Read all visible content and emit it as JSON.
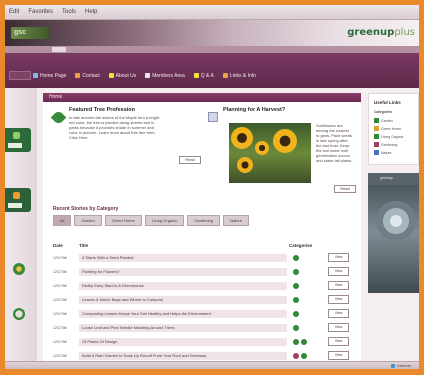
{
  "os_menu": [
    "Edit",
    "Favorites",
    "Tools",
    "Help"
  ],
  "site": {
    "logo_text": "gsc",
    "brand_main": "greenup",
    "brand_suffix": "plus"
  },
  "nav": {
    "first": "",
    "items": [
      {
        "label": "Home Page",
        "color": "#7fc0e8"
      },
      {
        "label": "Contact",
        "color": "#f0a040"
      },
      {
        "label": "About Us",
        "color": "#f0e040"
      },
      {
        "label": "Members Area",
        "color": "#e8e8e8"
      },
      {
        "label": "Q & A",
        "color": "#f0e040"
      },
      {
        "label": "Links & Info",
        "color": "#f0a040"
      }
    ]
  },
  "main": {
    "header": "Home",
    "feature_left": {
      "title": "Featured Tree Profession",
      "lines": [
        "In late autumn the leaves of the Maple turn a bright",
        "red color, the tree is planted along streets and in",
        "parks because it provides shade in summer and",
        "color in autumn. Learn more about this tree here.",
        "Click Here"
      ],
      "button": "Read"
    },
    "feature_right": {
      "title": "Planning for A Harvest?",
      "lines": [
        "Sunflowers are",
        "among the easiest",
        "to grow. Plant seeds",
        "in late spring after",
        "the last frost. Keep",
        "the soil moist until",
        "germination occurs",
        "and stake tall plants."
      ],
      "button": "Read"
    },
    "categories_title": "Recent Stories by Category",
    "tabs": [
      "All",
      "Garden",
      "Green Home",
      "Living Organic",
      "Gardening",
      "Nature"
    ],
    "table_headers": {
      "date": "Date",
      "title": "Title",
      "categories": "Categories"
    },
    "rows": [
      {
        "date": "12/17/06",
        "title": "It Starts With a Seed Planted",
        "cats": [
          "#2f8a35"
        ],
        "btn": "View"
      },
      {
        "date": "12/17/06",
        "title": "Planting for Flowers?",
        "cats": [
          "#2f8a35"
        ],
        "btn": "View"
      },
      {
        "date": "12/17/06",
        "title": "Really Early Start to A Greenhouse",
        "cats": [
          "#2f8a35"
        ],
        "btn": "View"
      },
      {
        "date": "12/17/06",
        "title": "Leaves & Mulch Bags and Where to Compost",
        "cats": [
          "#2f8a35"
        ],
        "btn": "View"
      },
      {
        "date": "12/17/06",
        "title": "Composting Leaves Keeps Your Soil Healthy and Helps the Environment",
        "cats": [
          "#2f8a35"
        ],
        "btn": "View"
      },
      {
        "date": "12/17/06",
        "title": "Loose Leaf and Pine Needle Mulching Around Trees",
        "cats": [
          "#2f8a35"
        ],
        "btn": "View"
      },
      {
        "date": "12/17/06",
        "title": "Of Plants Of Design",
        "cats": [
          "#2f8a35",
          "#2f8a35"
        ],
        "btn": "View"
      },
      {
        "date": "12/17/06",
        "title": "Build A Rain Garden to Soak Up Runoff From Your Roof and Driveway",
        "cats": [
          "#a04060",
          "#2f8a35"
        ],
        "btn": "View"
      }
    ]
  },
  "sidebar": {
    "title": "Useful Links",
    "subtitle": "Categories",
    "items": [
      {
        "label": "Garden",
        "color": "#2f8a35"
      },
      {
        "label": "Green Home",
        "color": "#e0a030"
      },
      {
        "label": "Living Organic",
        "color": "#2f8a35"
      },
      {
        "label": "Gardening",
        "color": "#a04060"
      },
      {
        "label": "Nature",
        "color": "#4a70c0"
      }
    ],
    "banner_title": "greenup"
  },
  "status": {
    "zone": "Internet"
  }
}
